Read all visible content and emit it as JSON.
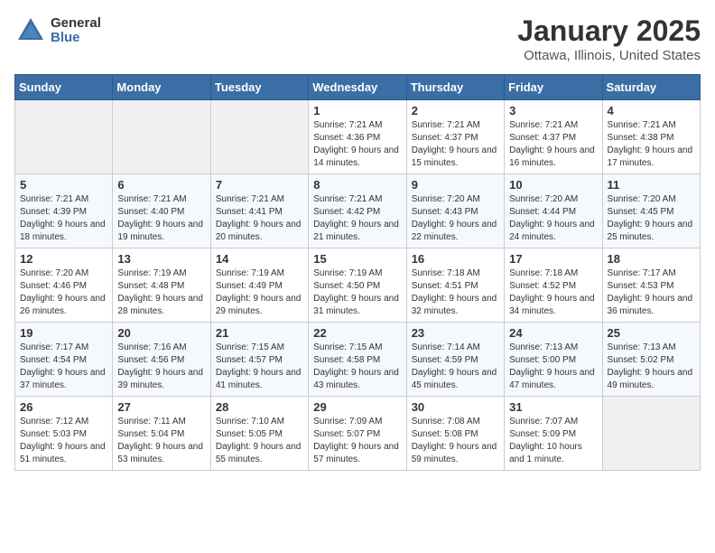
{
  "header": {
    "logo_general": "General",
    "logo_blue": "Blue",
    "month_title": "January 2025",
    "location": "Ottawa, Illinois, United States"
  },
  "days_of_week": [
    "Sunday",
    "Monday",
    "Tuesday",
    "Wednesday",
    "Thursday",
    "Friday",
    "Saturday"
  ],
  "weeks": [
    [
      {
        "day": "",
        "empty": true
      },
      {
        "day": "",
        "empty": true
      },
      {
        "day": "",
        "empty": true
      },
      {
        "day": "1",
        "sunrise": "7:21 AM",
        "sunset": "4:36 PM",
        "daylight": "9 hours and 14 minutes."
      },
      {
        "day": "2",
        "sunrise": "7:21 AM",
        "sunset": "4:37 PM",
        "daylight": "9 hours and 15 minutes."
      },
      {
        "day": "3",
        "sunrise": "7:21 AM",
        "sunset": "4:37 PM",
        "daylight": "9 hours and 16 minutes."
      },
      {
        "day": "4",
        "sunrise": "7:21 AM",
        "sunset": "4:38 PM",
        "daylight": "9 hours and 17 minutes."
      }
    ],
    [
      {
        "day": "5",
        "sunrise": "7:21 AM",
        "sunset": "4:39 PM",
        "daylight": "9 hours and 18 minutes."
      },
      {
        "day": "6",
        "sunrise": "7:21 AM",
        "sunset": "4:40 PM",
        "daylight": "9 hours and 19 minutes."
      },
      {
        "day": "7",
        "sunrise": "7:21 AM",
        "sunset": "4:41 PM",
        "daylight": "9 hours and 20 minutes."
      },
      {
        "day": "8",
        "sunrise": "7:21 AM",
        "sunset": "4:42 PM",
        "daylight": "9 hours and 21 minutes."
      },
      {
        "day": "9",
        "sunrise": "7:20 AM",
        "sunset": "4:43 PM",
        "daylight": "9 hours and 22 minutes."
      },
      {
        "day": "10",
        "sunrise": "7:20 AM",
        "sunset": "4:44 PM",
        "daylight": "9 hours and 24 minutes."
      },
      {
        "day": "11",
        "sunrise": "7:20 AM",
        "sunset": "4:45 PM",
        "daylight": "9 hours and 25 minutes."
      }
    ],
    [
      {
        "day": "12",
        "sunrise": "7:20 AM",
        "sunset": "4:46 PM",
        "daylight": "9 hours and 26 minutes."
      },
      {
        "day": "13",
        "sunrise": "7:19 AM",
        "sunset": "4:48 PM",
        "daylight": "9 hours and 28 minutes."
      },
      {
        "day": "14",
        "sunrise": "7:19 AM",
        "sunset": "4:49 PM",
        "daylight": "9 hours and 29 minutes."
      },
      {
        "day": "15",
        "sunrise": "7:19 AM",
        "sunset": "4:50 PM",
        "daylight": "9 hours and 31 minutes."
      },
      {
        "day": "16",
        "sunrise": "7:18 AM",
        "sunset": "4:51 PM",
        "daylight": "9 hours and 32 minutes."
      },
      {
        "day": "17",
        "sunrise": "7:18 AM",
        "sunset": "4:52 PM",
        "daylight": "9 hours and 34 minutes."
      },
      {
        "day": "18",
        "sunrise": "7:17 AM",
        "sunset": "4:53 PM",
        "daylight": "9 hours and 36 minutes."
      }
    ],
    [
      {
        "day": "19",
        "sunrise": "7:17 AM",
        "sunset": "4:54 PM",
        "daylight": "9 hours and 37 minutes."
      },
      {
        "day": "20",
        "sunrise": "7:16 AM",
        "sunset": "4:56 PM",
        "daylight": "9 hours and 39 minutes."
      },
      {
        "day": "21",
        "sunrise": "7:15 AM",
        "sunset": "4:57 PM",
        "daylight": "9 hours and 41 minutes."
      },
      {
        "day": "22",
        "sunrise": "7:15 AM",
        "sunset": "4:58 PM",
        "daylight": "9 hours and 43 minutes."
      },
      {
        "day": "23",
        "sunrise": "7:14 AM",
        "sunset": "4:59 PM",
        "daylight": "9 hours and 45 minutes."
      },
      {
        "day": "24",
        "sunrise": "7:13 AM",
        "sunset": "5:00 PM",
        "daylight": "9 hours and 47 minutes."
      },
      {
        "day": "25",
        "sunrise": "7:13 AM",
        "sunset": "5:02 PM",
        "daylight": "9 hours and 49 minutes."
      }
    ],
    [
      {
        "day": "26",
        "sunrise": "7:12 AM",
        "sunset": "5:03 PM",
        "daylight": "9 hours and 51 minutes."
      },
      {
        "day": "27",
        "sunrise": "7:11 AM",
        "sunset": "5:04 PM",
        "daylight": "9 hours and 53 minutes."
      },
      {
        "day": "28",
        "sunrise": "7:10 AM",
        "sunset": "5:05 PM",
        "daylight": "9 hours and 55 minutes."
      },
      {
        "day": "29",
        "sunrise": "7:09 AM",
        "sunset": "5:07 PM",
        "daylight": "9 hours and 57 minutes."
      },
      {
        "day": "30",
        "sunrise": "7:08 AM",
        "sunset": "5:08 PM",
        "daylight": "9 hours and 59 minutes."
      },
      {
        "day": "31",
        "sunrise": "7:07 AM",
        "sunset": "5:09 PM",
        "daylight": "10 hours and 1 minute."
      },
      {
        "day": "",
        "empty": true
      }
    ]
  ]
}
